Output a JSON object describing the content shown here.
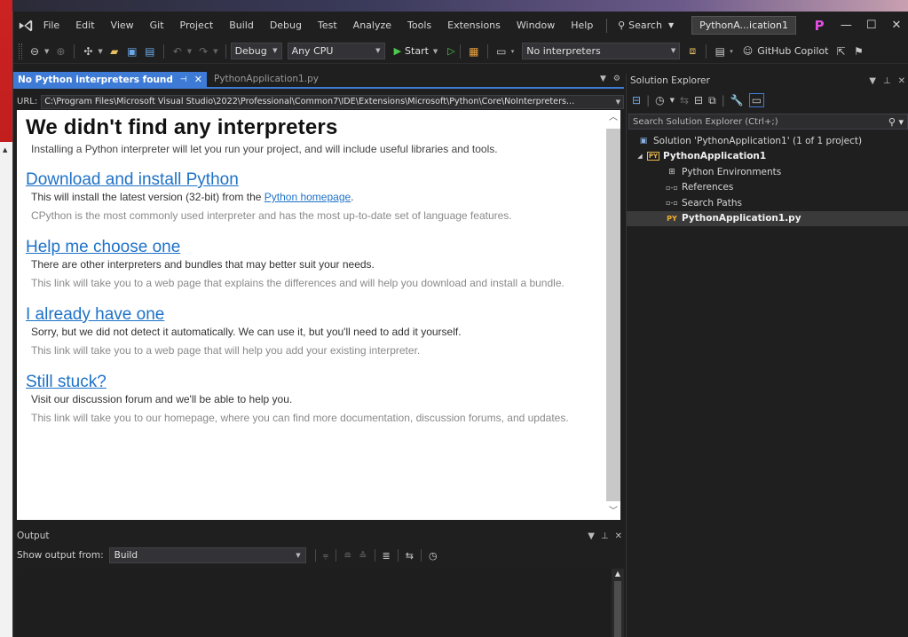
{
  "menubar": {
    "items": [
      "File",
      "Edit",
      "View",
      "Git",
      "Project",
      "Build",
      "Debug",
      "Test",
      "Analyze",
      "Tools",
      "Extensions",
      "Window",
      "Help"
    ],
    "search_label": "Search",
    "solution_name": "PythonA...ication1",
    "profile_initial": "P",
    "window_buttons": [
      "—",
      "☐",
      "✕"
    ]
  },
  "toolbar": {
    "configuration": "Debug",
    "platform": "Any CPU",
    "start_label": "Start",
    "interpreter": "No interpreters",
    "copilot_label": "GitHub Copilot"
  },
  "doc_tabs": {
    "active": "No Python interpreters found",
    "inactive": "PythonApplication1.py"
  },
  "url_bar": {
    "label": "URL:",
    "value": "C:\\Program Files\\Microsoft Visual Studio\\2022\\Professional\\Common7\\IDE\\Extensions\\Microsoft\\Python\\Core\\NoInterpreters..."
  },
  "page": {
    "title": "We didn't find any interpreters",
    "subtitle": "Installing a Python interpreter will let you run your project, and will include useful libraries and tools.",
    "sections": [
      {
        "heading": "Download and install Python",
        "line_before": "This will install the latest version (32-bit) from the ",
        "line_link": "Python homepage",
        "line_after": ".",
        "muted": "CPython is the most commonly used interpreter and has the most up-to-date set of language features."
      },
      {
        "heading": "Help me choose one",
        "line": "There are other interpreters and bundles that may better suit your needs.",
        "muted": "This link will take you to a web page that explains the differences and will help you download and install a bundle."
      },
      {
        "heading": "I already have one",
        "line": "Sorry, but we did not detect it automatically. We can use it, but you'll need to add it yourself.",
        "muted": "This link will take you to a web page that will help you add your existing interpreter."
      },
      {
        "heading": "Still stuck?",
        "line": "Visit our discussion forum and we'll be able to help you.",
        "muted": "This link will take you to our homepage, where you can find more documentation, discussion forums, and updates."
      }
    ]
  },
  "output": {
    "title": "Output",
    "show_from_label": "Show output from:",
    "source": "Build"
  },
  "solution_explorer": {
    "title": "Solution Explorer",
    "search_placeholder": "Search Solution Explorer (Ctrl+;)",
    "solution": "Solution 'PythonApplication1' (1 of 1 project)",
    "project": "PythonApplication1",
    "items": [
      "Python Environments",
      "References",
      "Search Paths"
    ],
    "file_badge": "PY",
    "file": "PythonApplication1.py"
  },
  "colors": {
    "accent": "#3e7bd6",
    "link": "#1e72c8",
    "start_green": "#4ec94e",
    "profile": "#e04fe0"
  }
}
